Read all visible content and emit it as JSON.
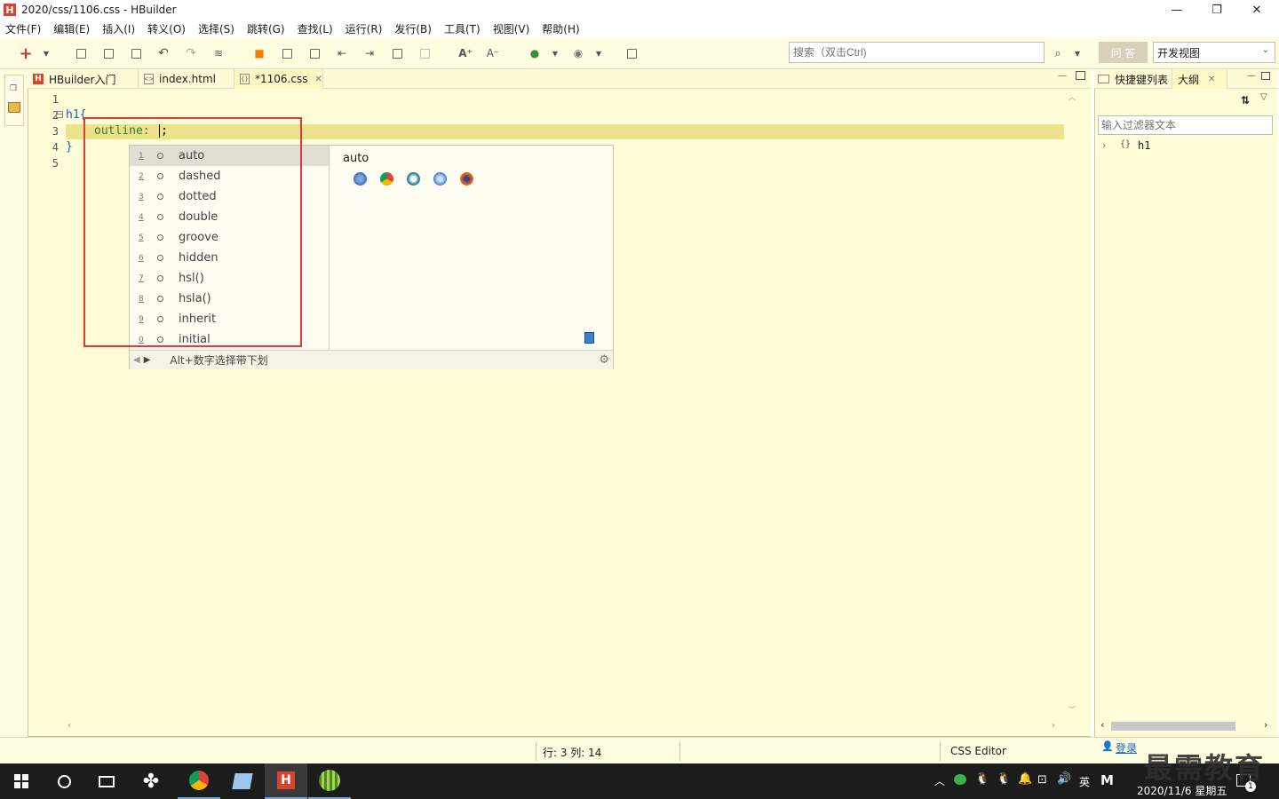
{
  "window": {
    "title": "2020/css/1106.css  -  HBuilder",
    "app_icon": "H",
    "minimize": "—",
    "maximize": "❐",
    "close": "✕"
  },
  "menu": [
    "文件(F)",
    "编辑(E)",
    "插入(I)",
    "转义(O)",
    "选择(S)",
    "跳转(G)",
    "查找(L)",
    "运行(R)",
    "发行(B)",
    "工具(T)",
    "视图(V)",
    "帮助(H)"
  ],
  "toolbar": {
    "search_placeholder": "搜索（双击Ctrl)",
    "qa_label": "问 答",
    "view_value": "开发视图"
  },
  "editor_tabs": [
    {
      "label": "HBuilder入门",
      "icon": "hbuilder-icon"
    },
    {
      "label": "index.html",
      "icon": "html-file-icon"
    },
    {
      "label": "*1106.css",
      "icon": "css-file-icon",
      "close": "✕"
    }
  ],
  "code": {
    "line_numbers": [
      "1",
      "2",
      "3",
      "4",
      "5"
    ],
    "line2": "h1{",
    "line3_prop": "outline:",
    "line3_val": ";",
    "line4": "}"
  },
  "autocomplete": {
    "items": [
      {
        "num": "1",
        "label": "auto"
      },
      {
        "num": "2",
        "label": "dashed"
      },
      {
        "num": "3",
        "label": "dotted"
      },
      {
        "num": "4",
        "label": "double"
      },
      {
        "num": "5",
        "label": "groove"
      },
      {
        "num": "6",
        "label": "hidden"
      },
      {
        "num": "7",
        "label": "hsl()"
      },
      {
        "num": "8",
        "label": "hsla()"
      },
      {
        "num": "9",
        "label": "inherit"
      },
      {
        "num": "0",
        "label": "initial"
      }
    ],
    "detail_title": "auto",
    "footer_hint": "Alt+数字选择带下划"
  },
  "right_panel": {
    "tab_shortcuts": "快捷键列表",
    "tab_outline": "大纲",
    "filter_placeholder": "输入过滤器文本",
    "tree_item": "h1",
    "tree_item_icon": "{}"
  },
  "status": {
    "position": "行: 3 列: 14",
    "editor_type": "CSS Editor",
    "login": "登录"
  },
  "taskbar": {
    "clock_date": "2020/11/6 星期五",
    "ime": "英",
    "notif_count": "1",
    "watermark": "最需教育"
  },
  "colors": {
    "accent_red": "#e53935",
    "editor_bg": "#fffdd8",
    "current_line": "#ece28a",
    "hbuilder_brand": "#d8452f"
  }
}
